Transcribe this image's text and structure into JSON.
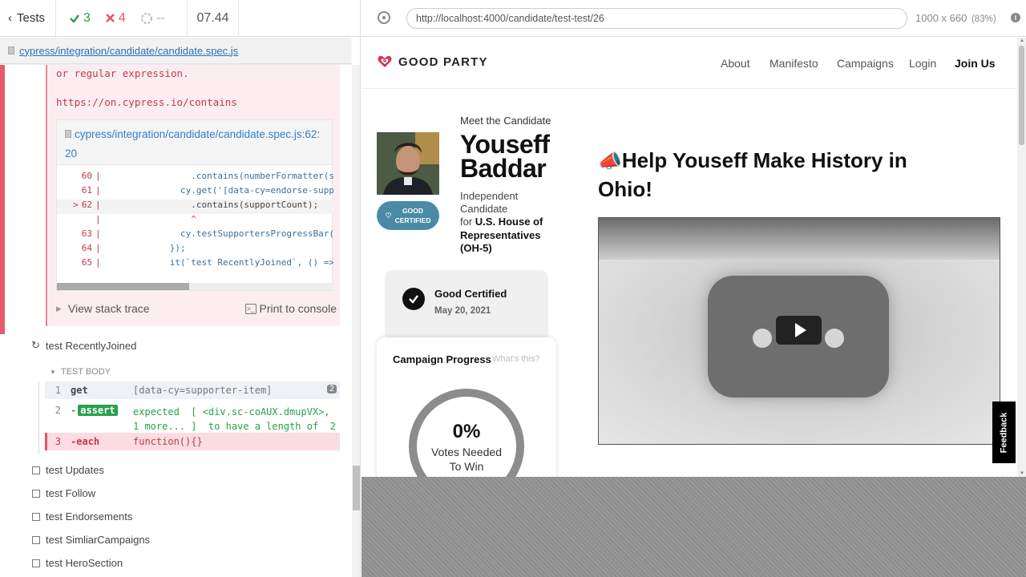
{
  "reporter": {
    "tests_label": "Tests",
    "passed": "3",
    "failed": "4",
    "pending": "--",
    "duration": "07.44",
    "spec_path": "cypress/integration/candidate/candidate.spec.js",
    "error": {
      "text_line": "or regular expression.",
      "doc_link": "https://on.cypress.io/contains",
      "file_ref": "cypress/integration/candidate/candidate.spec.js:62:20",
      "code_lines": [
        {
          "num": "60",
          "marker": "",
          "code": "                .contains(numberFormatter(s"
        },
        {
          "num": "61",
          "marker": "",
          "code": "              cy.get('[data-cy=endorse-supp"
        },
        {
          "num": "62",
          "marker": ">",
          "code": "                .contains(supportCount);"
        },
        {
          "num": "",
          "marker": "",
          "code": "                ^"
        },
        {
          "num": "63",
          "marker": "",
          "code": "              cy.testSupportersProgressBar("
        },
        {
          "num": "64",
          "marker": "",
          "code": "            });"
        },
        {
          "num": "65",
          "marker": "",
          "code": "            it(`test RecentlyJoined`, () => {"
        }
      ],
      "view_stack": "View stack trace",
      "print_console": "Print to console"
    },
    "current_test": "test RecentlyJoined",
    "test_body_label": "TEST BODY",
    "commands": [
      {
        "num": "1",
        "name": "get",
        "message": "[data-cy=supporter-item]",
        "badge": "2"
      },
      {
        "num": "2",
        "name": "-assert",
        "message_line1": "expected  [ <div.sc-coAUX.dmupVX>,",
        "message_line2": "1 more... ]  to have a length of  2"
      },
      {
        "num": "3",
        "name": "-each",
        "message": "function(){}"
      }
    ],
    "pending_tests": [
      "test Updates",
      "test Follow",
      "test Endorsements",
      "test SimliarCampaigns",
      "test HeroSection"
    ]
  },
  "aut": {
    "url": "http://localhost:4000/candidate/test-test/26",
    "viewport_size": "1000 x 660",
    "scale": "(83%)"
  },
  "page": {
    "brand": "GOOD PARTY",
    "nav": [
      "About",
      "Manifesto",
      "Campaigns",
      "Login",
      "Join Us"
    ],
    "meet_label": "Meet the Candidate",
    "first_name": "Youseff",
    "last_name": "Baddar",
    "party_line1": "Independent",
    "party_line2": "Candidate",
    "for_label": "for",
    "race_line1": "U.S. House of",
    "race_line2": "Representatives",
    "race_line3": "(OH-5)",
    "good_certified_badge_line1": "GOOD",
    "good_certified_badge_line2": "CERTIFIED",
    "certified_title": "Good Certified",
    "certified_date": "May 20, 2021",
    "progress_title": "Campaign Progress",
    "progress_help": "What's this?",
    "progress_percent": "0%",
    "progress_label_line1": "Votes Needed",
    "progress_label_line2": "To Win",
    "progress_value": 0,
    "headline_line1": "Help Youseff Make History in",
    "headline_line2": "Ohio!",
    "feedback": "Feedback"
  },
  "colors": {
    "pass": "#2aa04a",
    "fail": "#e05565",
    "link": "#2b6fb3",
    "brand_red": "#d9344b",
    "badge_teal": "#4a8aa6"
  }
}
